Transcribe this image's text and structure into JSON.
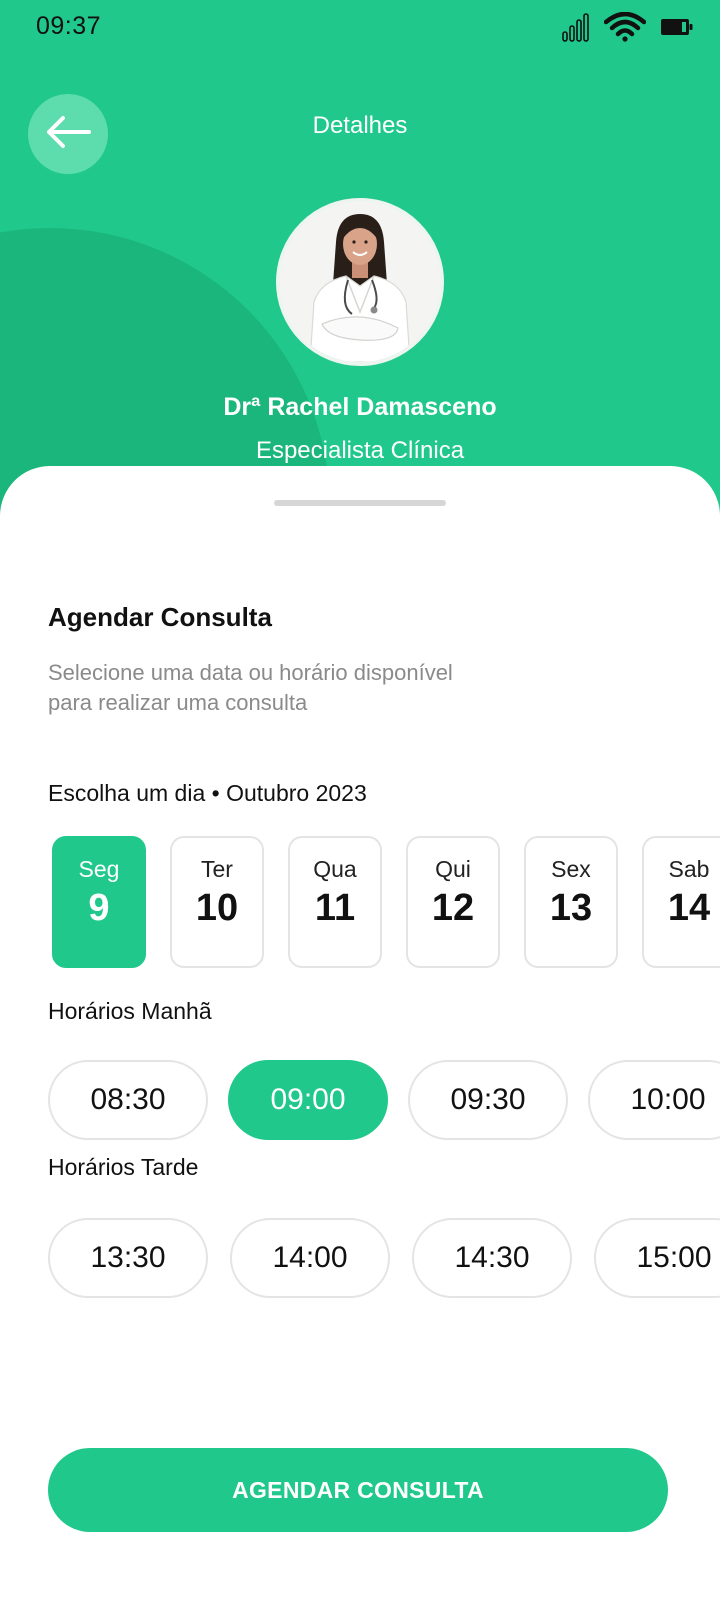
{
  "status_bar": {
    "time": "09:37",
    "icons": [
      "signal-icon",
      "wifi-icon",
      "battery-icon"
    ]
  },
  "header": {
    "title": "Detalhes",
    "back_icon": "arrow-left-icon"
  },
  "doctor": {
    "name": "Drª Rachel Damasceno",
    "role": "Especialista Clínica"
  },
  "schedule": {
    "title": "Agendar Consulta",
    "subtitle_line1": "Selecione uma data ou horário disponível",
    "subtitle_line2": "para realizar uma consulta",
    "day_label": "Escolha um dia • Outubro 2023",
    "days": [
      {
        "name": "Seg",
        "number": "9",
        "selected": true
      },
      {
        "name": "Ter",
        "number": "10",
        "selected": false
      },
      {
        "name": "Qua",
        "number": "11",
        "selected": false
      },
      {
        "name": "Qui",
        "number": "12",
        "selected": false
      },
      {
        "name": "Sex",
        "number": "13",
        "selected": false
      },
      {
        "name": "Sab",
        "number": "14",
        "selected": false
      }
    ],
    "morning_label": "Horários Manhã",
    "morning_slots": [
      {
        "time": "08:30",
        "selected": false
      },
      {
        "time": "09:00",
        "selected": true
      },
      {
        "time": "09:30",
        "selected": false
      },
      {
        "time": "10:00",
        "selected": false
      }
    ],
    "afternoon_label": "Horários Tarde",
    "afternoon_slots": [
      {
        "time": "13:30",
        "selected": false
      },
      {
        "time": "14:00",
        "selected": false
      },
      {
        "time": "14:30",
        "selected": false
      },
      {
        "time": "15:00",
        "selected": false
      }
    ],
    "cta_label": "AGENDAR CONSULTA"
  },
  "colors": {
    "primary": "#20C98B",
    "primary_dark": "#1BB67C",
    "back_button": "#5DDCAD",
    "border": "#E4E4E4",
    "muted_text": "#8A8A8A"
  }
}
